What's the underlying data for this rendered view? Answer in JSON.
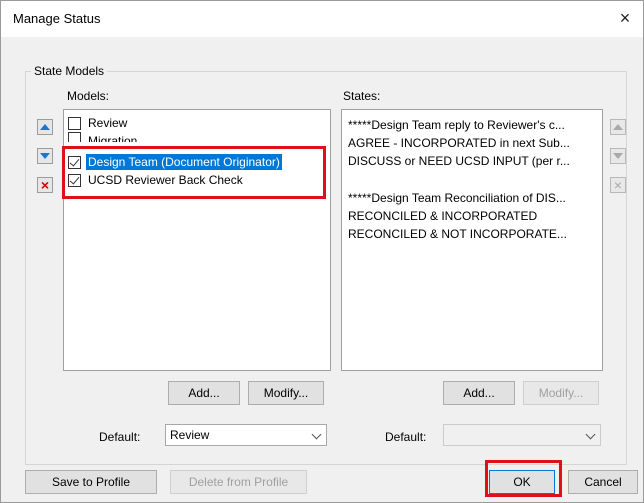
{
  "dialog": {
    "title": "Manage Status",
    "close_glyph": "×"
  },
  "group": {
    "legend": "State Models"
  },
  "models": {
    "label": "Models:",
    "items": [
      {
        "label": "Review",
        "checked": false,
        "selected": false
      },
      {
        "label": "Migration",
        "checked": false,
        "selected": false
      },
      {
        "label": "Design Team (Document Originator)",
        "checked": true,
        "selected": true
      },
      {
        "label": "UCSD Reviewer Back Check",
        "checked": true,
        "selected": false
      }
    ],
    "add_label": "Add...",
    "modify_label": "Modify...",
    "default_label": "Default:",
    "default_value": "Review",
    "move_up_icon": "triangle-up",
    "move_down_icon": "triangle-down",
    "delete_icon": "red-x"
  },
  "states": {
    "label": "States:",
    "lines": [
      "*****Design Team reply to Reviewer's c...",
      "AGREE - INCORPORATED in next Sub...",
      "DISCUSS or NEED UCSD INPUT (per r...",
      "",
      "*****Design Team Reconciliation of DIS...",
      "RECONCILED & INCORPORATED",
      "RECONCILED & NOT INCORPORATE..."
    ],
    "add_label": "Add...",
    "modify_label": "Modify...",
    "default_label": "Default:",
    "default_value": ""
  },
  "footer": {
    "save_label": "Save to Profile",
    "delete_label": "Delete from Profile",
    "ok_label": "OK",
    "cancel_label": "Cancel"
  },
  "colors": {
    "selection": "#0078d7",
    "highlight": "#e0101a",
    "arrow": "#1976d2",
    "delete": "#dd0000"
  }
}
